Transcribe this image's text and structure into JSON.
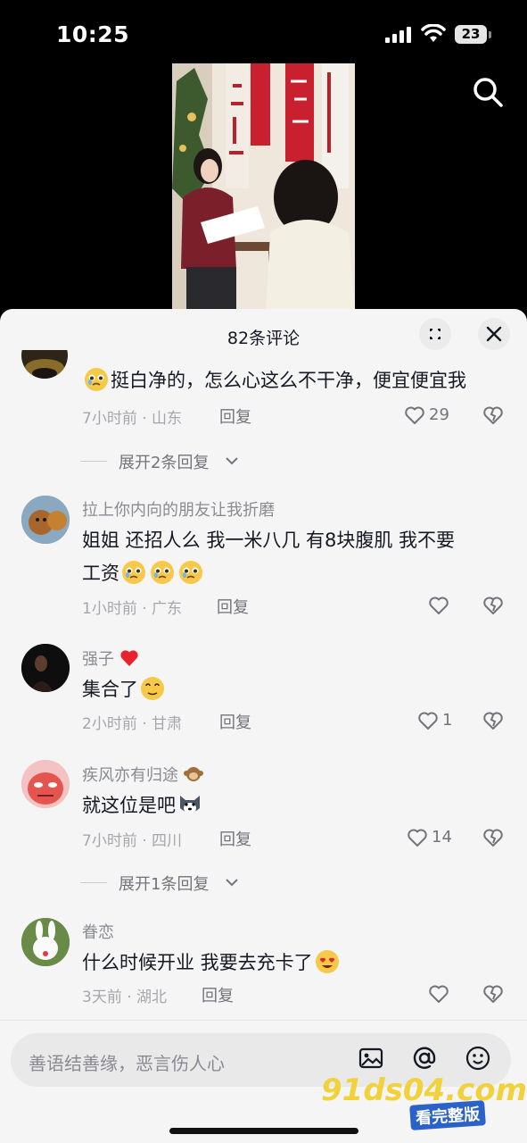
{
  "status_bar": {
    "time": "10:25",
    "battery": "23"
  },
  "sheet": {
    "title": "82条评论"
  },
  "comments": [
    {
      "username": "",
      "text": "挺白净的，怎么心这么不干净，便宜便宜我",
      "time_location": "7小时前 · 山东",
      "reply_label": "回复",
      "likes": "29",
      "expand_replies": "展开2条回复"
    },
    {
      "username": "拉上你内向的朋友让我折磨",
      "text_line1": "姐姐 还招人么 我一米八几  有8块腹肌 我不要",
      "text_line2": "工资",
      "time_location": "1小时前 · 广东",
      "reply_label": "回复",
      "likes": ""
    },
    {
      "username": "强子",
      "text": "集合了",
      "time_location": "2小时前 · 甘肃",
      "reply_label": "回复",
      "likes": "1"
    },
    {
      "username": "疾风亦有归途",
      "text": "就这位是吧",
      "time_location": "7小时前 · 四川",
      "reply_label": "回复",
      "likes": "14",
      "expand_replies": "展开1条回复"
    },
    {
      "username": "眷恋",
      "text": "什么时候开业 我要去充卡了",
      "time_location": "3天前 · 湖北",
      "reply_label": "回复",
      "likes": ""
    }
  ],
  "input": {
    "placeholder": "善语结善缘，恶言伤人心"
  },
  "watermark": {
    "line1": "91ds04.com",
    "line2": "看完整版"
  },
  "colors": {
    "sheet_bg": "#f5f5f5",
    "text_primary": "#161823",
    "text_secondary": "#8a8b91"
  },
  "icons": [
    "search-icon",
    "expand-icon",
    "close-icon",
    "heart-icon",
    "broken-heart-icon",
    "image-icon",
    "at-icon",
    "emoji-icon"
  ]
}
